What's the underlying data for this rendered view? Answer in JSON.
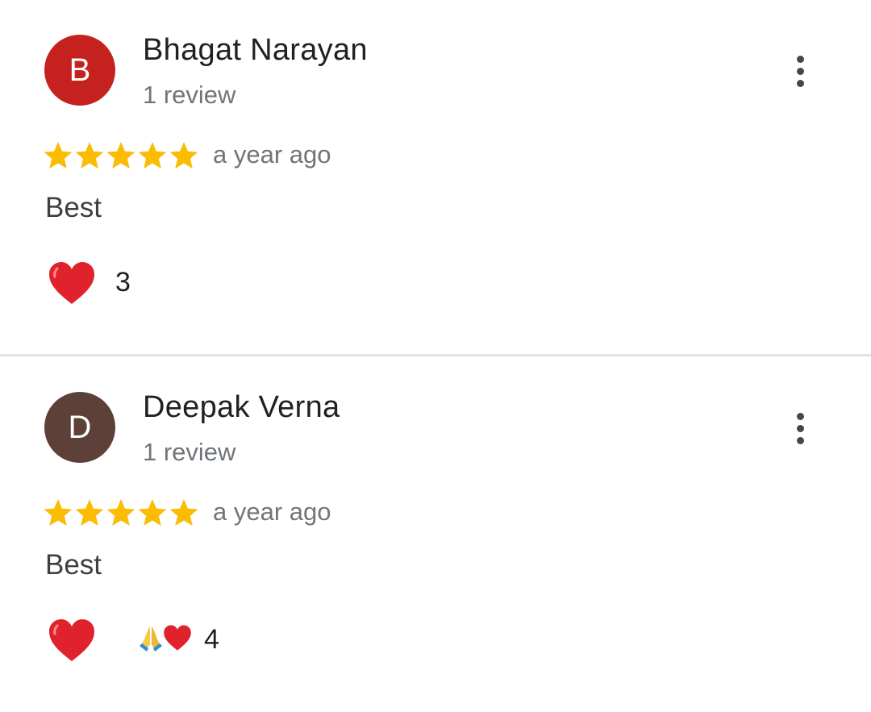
{
  "reviews": [
    {
      "avatar_letter": "B",
      "avatar_color": "#c5221f",
      "name": "Bhagat Narayan",
      "review_count": "1 review",
      "rating": 5,
      "time": "a year ago",
      "text": "Best",
      "reactions": [
        "heart-emoji"
      ],
      "reaction_count": "3"
    },
    {
      "avatar_letter": "D",
      "avatar_color": "#5d4037",
      "name": "Deepak Verna",
      "review_count": "1 review",
      "rating": 5,
      "time": "a year ago",
      "text": "Best",
      "reactions": [
        "heart-emoji",
        "folded-hands-emoji",
        "heart-emoji"
      ],
      "reaction_count": "4"
    }
  ],
  "colors": {
    "star": "#fbbc04",
    "heart": "#e0222c",
    "secondary_text": "#70757a",
    "divider": "#e3e3e3"
  }
}
